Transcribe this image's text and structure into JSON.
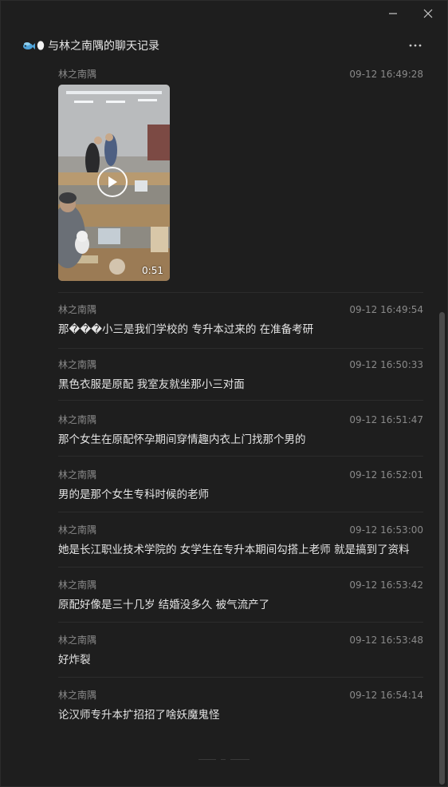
{
  "window": {
    "title": "与林之南隅的聊天记录",
    "controls": [
      "minimize-icon",
      "close-icon"
    ]
  },
  "header": {
    "icons": [
      "fish-icon",
      "egg-icon"
    ],
    "more_icon": "more-dots-icon"
  },
  "messages": [
    {
      "sender": "林之南隅",
      "time": "09-12 16:49:28",
      "type": "video",
      "duration": "0:51"
    },
    {
      "sender": "林之南隅",
      "time": "09-12 16:49:54",
      "text": "那���小三是我们学校的 专升本过来的 在准备考研"
    },
    {
      "sender": "林之南隅",
      "time": "09-12 16:50:33",
      "text": "黑色衣服是原配 我室友就坐那小三对面"
    },
    {
      "sender": "林之南隅",
      "time": "09-12 16:51:47",
      "text": "那个女生在原配怀孕期间穿情趣内衣上门找那个男的"
    },
    {
      "sender": "林之南隅",
      "time": "09-12 16:52:01",
      "text": "男的是那个女生专科时候的老师"
    },
    {
      "sender": "林之南隅",
      "time": "09-12 16:53:00",
      "text": "她是长江职业技术学院的 女学生在专升本期间勾搭上老师 就是搞到了资料"
    },
    {
      "sender": "林之南隅",
      "time": "09-12 16:53:42",
      "text": "原配好像是三十几岁 结婚没多久 被气流产了"
    },
    {
      "sender": "林之南隅",
      "time": "09-12 16:53:48",
      "text": "好炸裂"
    },
    {
      "sender": "林之南隅",
      "time": "09-12 16:54:14",
      "text": "论汉师专升本扩招招了啥妖魔鬼怪"
    }
  ],
  "colors": {
    "background": "#1e1e1e",
    "text": "#e4e4e4",
    "meta": "#8a8a8a",
    "divider": "#2c2c2c",
    "scrollbar": "#4a4a4a"
  }
}
